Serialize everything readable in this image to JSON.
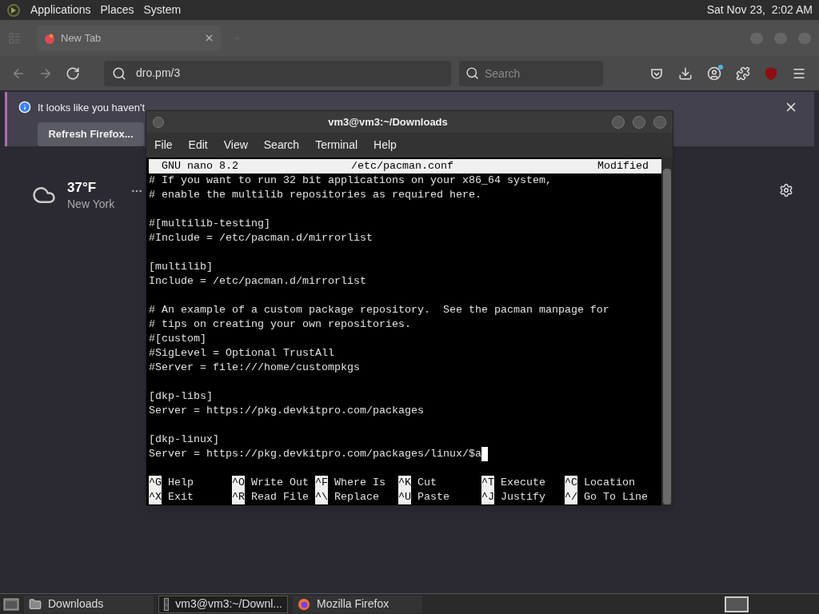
{
  "top_panel": {
    "menus": [
      "Applications",
      "Places",
      "System"
    ],
    "clock": "Sat Nov 23,  2:02 AM"
  },
  "browser": {
    "tab": {
      "title": "New Tab"
    },
    "url": "dro.pm/3",
    "search": {
      "placeholder": "Search"
    },
    "notification": {
      "text": "It looks like you haven't",
      "button": "Refresh Firefox..."
    },
    "weather": {
      "temperature": "37°F",
      "city": "New York"
    }
  },
  "terminal": {
    "title": "vm3@vm3:~/Downloads",
    "menus": [
      "File",
      "Edit",
      "View",
      "Search",
      "Terminal",
      "Help"
    ],
    "nano": {
      "version": "GNU nano 8.2",
      "file": "/etc/pacman.conf",
      "status": "Modified",
      "lines": [
        {
          "kind": "text",
          "text": "# If you want to run 32 bit applications on your x86_64 system,",
          "cursor": false
        },
        {
          "kind": "text",
          "text": "# enable the multilib repositories as required here.",
          "cursor": false
        },
        {
          "kind": "blank"
        },
        {
          "kind": "text",
          "text": "#[multilib-testing]",
          "cursor": false
        },
        {
          "kind": "text",
          "text": "#Include = /etc/pacman.d/mirrorlist",
          "cursor": false
        },
        {
          "kind": "blank"
        },
        {
          "kind": "text",
          "text": "[multilib]",
          "cursor": false
        },
        {
          "kind": "text",
          "text": "Include = /etc/pacman.d/mirrorlist",
          "cursor": false
        },
        {
          "kind": "blank"
        },
        {
          "kind": "text",
          "text": "# An example of a custom package repository.  See the pacman manpage for",
          "cursor": false
        },
        {
          "kind": "text",
          "text": "# tips on creating your own repositories.",
          "cursor": false
        },
        {
          "kind": "text",
          "text": "#[custom]",
          "cursor": false
        },
        {
          "kind": "text",
          "text": "#SigLevel = Optional TrustAll",
          "cursor": false
        },
        {
          "kind": "text",
          "text": "#Server = file:///home/custompkgs",
          "cursor": false
        },
        {
          "kind": "blank"
        },
        {
          "kind": "text",
          "text": "[dkp-libs]",
          "cursor": false
        },
        {
          "kind": "text",
          "text": "Server = https://pkg.devkitpro.com/packages",
          "cursor": false
        },
        {
          "kind": "blank"
        },
        {
          "kind": "text",
          "text": "[dkp-linux]",
          "cursor": false
        },
        {
          "kind": "text",
          "text": "Server = https://pkg.devkitpro.com/packages/linux/$a",
          "cursor": true
        }
      ],
      "shortcuts": [
        {
          "key": "^G",
          "label": "Help"
        },
        {
          "key": "^O",
          "label": "Write Out"
        },
        {
          "key": "^F",
          "label": "Where Is"
        },
        {
          "key": "^K",
          "label": "Cut"
        },
        {
          "key": "^T",
          "label": "Execute"
        },
        {
          "key": "^C",
          "label": "Location"
        },
        {
          "key": "^X",
          "label": "Exit"
        },
        {
          "key": "^R",
          "label": "Read File"
        },
        {
          "key": "^\\",
          "label": "Replace"
        },
        {
          "key": "^U",
          "label": "Paste"
        },
        {
          "key": "^J",
          "label": "Justify"
        },
        {
          "key": "^/",
          "label": "Go To Line"
        }
      ]
    }
  },
  "taskbar": {
    "items": [
      {
        "kind": "folder",
        "label": "Downloads",
        "selected": false
      },
      {
        "kind": "terminal",
        "label": "vm3@vm3:~/Downl...",
        "selected": true
      },
      {
        "kind": "firefox",
        "label": "Mozilla Firefox",
        "selected": false
      }
    ]
  }
}
